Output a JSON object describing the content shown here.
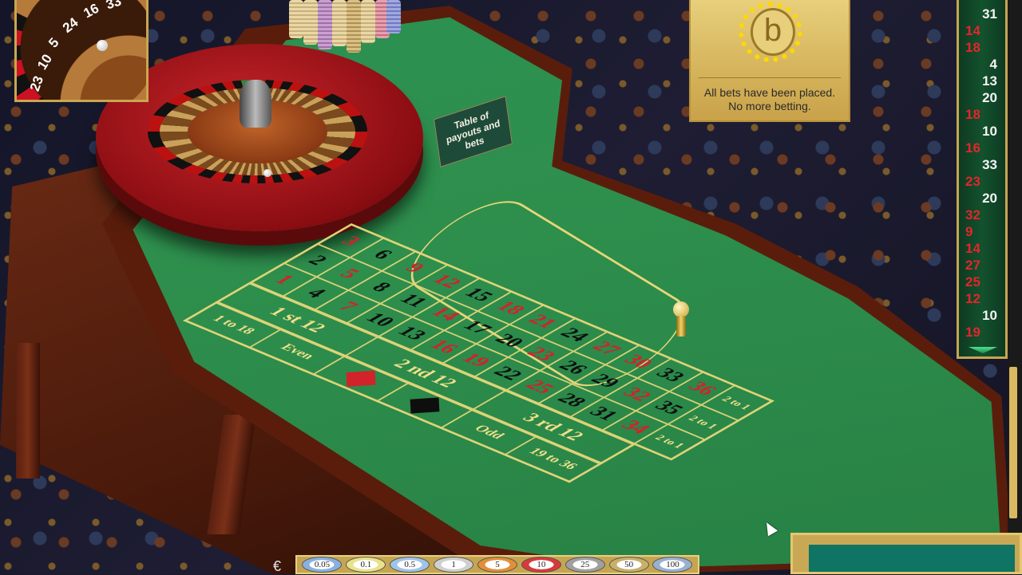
{
  "game": {
    "wheel_numbers_top_view": [
      "23",
      "10",
      "5",
      "24",
      "16",
      "33"
    ],
    "payout_sign": "Table of payouts and bets",
    "info_panel": {
      "logo_letter": "b",
      "message": "All bets have been placed. No more betting."
    },
    "history": {
      "entries": [
        {
          "value": "31",
          "color": "black"
        },
        {
          "value": "14",
          "color": "red"
        },
        {
          "value": "18",
          "color": "red"
        },
        {
          "value": "4",
          "color": "black"
        },
        {
          "value": "13",
          "color": "black"
        },
        {
          "value": "20",
          "color": "black"
        },
        {
          "value": "18",
          "color": "red"
        },
        {
          "value": "10",
          "color": "black"
        },
        {
          "value": "16",
          "color": "red"
        },
        {
          "value": "33",
          "color": "black"
        },
        {
          "value": "23",
          "color": "red"
        },
        {
          "value": "20",
          "color": "black"
        },
        {
          "value": "32",
          "color": "red"
        },
        {
          "value": "9",
          "color": "red"
        },
        {
          "value": "14",
          "color": "red"
        },
        {
          "value": "27",
          "color": "red"
        },
        {
          "value": "25",
          "color": "red"
        },
        {
          "value": "12",
          "color": "red"
        },
        {
          "value": "10",
          "color": "black"
        },
        {
          "value": "19",
          "color": "red"
        }
      ]
    },
    "layout": {
      "rows": [
        [
          "3",
          "6",
          "9",
          "12",
          "15",
          "18",
          "21",
          "24",
          "27",
          "30",
          "33",
          "36"
        ],
        [
          "2",
          "5",
          "8",
          "11",
          "14",
          "17",
          "20",
          "23",
          "26",
          "29",
          "32",
          "35"
        ],
        [
          "1",
          "4",
          "7",
          "10",
          "13",
          "16",
          "19",
          "22",
          "25",
          "28",
          "31",
          "34"
        ]
      ],
      "colors": {
        "3": "red",
        "6": "black",
        "9": "red",
        "12": "red",
        "15": "black",
        "18": "red",
        "21": "red",
        "24": "black",
        "27": "red",
        "30": "red",
        "33": "black",
        "36": "red",
        "2": "black",
        "5": "red",
        "8": "black",
        "11": "black",
        "14": "red",
        "17": "black",
        "20": "black",
        "23": "red",
        "26": "black",
        "29": "black",
        "32": "red",
        "35": "black",
        "1": "red",
        "4": "black",
        "7": "red",
        "10": "black",
        "13": "black",
        "16": "red",
        "19": "red",
        "22": "black",
        "25": "red",
        "28": "black",
        "31": "black",
        "34": "red"
      },
      "column_bets": [
        "2 to 1",
        "2 to 1",
        "2 to 1"
      ],
      "dozens": [
        "1 st 12",
        "2 nd 12",
        "3 rd 12"
      ],
      "outside": [
        "1 to 18",
        "Even",
        "",
        "",
        "Odd",
        "19 to 36"
      ]
    },
    "chip_tray": {
      "currency": "€",
      "chips": [
        {
          "label": "0.05",
          "color": "#8ab0e0"
        },
        {
          "label": "0.1",
          "color": "#e8e28a"
        },
        {
          "label": "0.5",
          "color": "#a0c4e8"
        },
        {
          "label": "1",
          "color": "#cfcfcf"
        },
        {
          "label": "5",
          "color": "#e0903a"
        },
        {
          "label": "10",
          "color": "#d83a3a"
        },
        {
          "label": "25",
          "color": "#a0a0a0"
        },
        {
          "label": "50",
          "color": "#c9b06a"
        },
        {
          "label": "100",
          "color": "#9ab0d0"
        }
      ]
    },
    "accent_colors": {
      "felt": "#2e8f4d",
      "gold": "#c6a552",
      "red": "#d2222a"
    }
  }
}
